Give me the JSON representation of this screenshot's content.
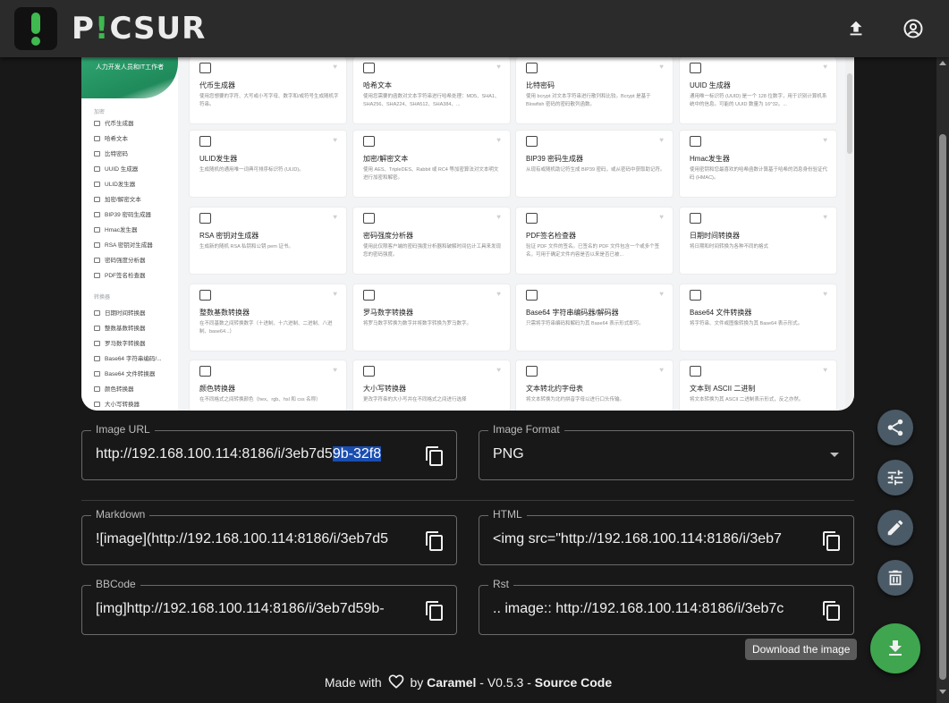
{
  "app": {
    "brand_prefix": "P",
    "brand_accent": "!",
    "brand_suffix": "CSUR",
    "accent_color": "#3fb950"
  },
  "appbar": {
    "upload_icon": "upload-icon",
    "account_icon": "account-circle-icon"
  },
  "preview": {
    "banner": "人力开发人员和IT工作者",
    "group_crypto": "加密",
    "group_convert": "转换器",
    "menu": [
      "代币生成器",
      "哈希文本",
      "比特密码",
      "UUID 生成器",
      "ULID发生器",
      "加密/解密文本",
      "BIP39 密码生成器",
      "Hmac发生器",
      "RSA 密钥对生成器",
      "密码强度分析器",
      "PDF签名检查器",
      "日期时间转换器",
      "整数基数转换器",
      "罗马数字转换器",
      "Base64 字符串编码/...",
      "Base64 文件转换器",
      "颜色转换器",
      "大小写转换器"
    ],
    "cards": [
      {
        "t": "代币生成器",
        "d": "使用您想要的字符、大写或小写字母、数字和/或符号生成随机字符串。"
      },
      {
        "t": "哈希文本",
        "d": "使用您需要的函数对文本字符串进行哈希处理：MD5、SHA1、SHA256、SHA224、SHA512、SHA384、..."
      },
      {
        "t": "比特密码",
        "d": "使用 bcrypt 对文本字符串进行散列和比较。Bcrypt 是基于 Blowfish 密码的密码散列函数。"
      },
      {
        "t": "UUID 生成器",
        "d": "通用唯一标识符 (UUID) 是一个 128 位数字，用于识别计算机系统中的信息。可能的 UUID 数量为 16^32。..."
      },
      {
        "t": "ULID发生器",
        "d": "生成随机的通用唯一词典可排序标识符 (ULID)。"
      },
      {
        "t": "加密/解密文本",
        "d": "使用 AES、TripleDES、Rabbit 或 RC4 等加密算法对文本明文进行加密和解密。"
      },
      {
        "t": "BIP39 密码生成器",
        "d": "从现有或随机助记符生成 BIP39 密码，或从密码中获取助记符。"
      },
      {
        "t": "Hmac发生器",
        "d": "使用密钥和您最喜欢的哈希函数计算基于哈希的消息身份验证代码 (HMAC)。"
      },
      {
        "t": "RSA 密钥对生成器",
        "d": "生成新的随机 RSA 私钥和公钥 pem 证书。"
      },
      {
        "t": "密码强度分析器",
        "d": "使用此仅限客户端的密码强度分析器和破解时间估计工具来发现您的密码强度。"
      },
      {
        "t": "PDF签名检查器",
        "d": "验证 PDF 文件的签名。已签名的 PDF 文件包含一个或多个签名，可用于确定文件内容是否以来是否已被..."
      },
      {
        "t": "日期时间转换器",
        "d": "将日期和时间转换为各种不同的格式"
      },
      {
        "t": "整数基数转换器",
        "d": "在不同基数之间转换数字（十进制、十六进制、二进制、八进制、base64...）"
      },
      {
        "t": "罗马数字转换器",
        "d": "将罗马数字转换为数字并将数字转换为罗马数字。"
      },
      {
        "t": "Base64 字符串编码器/解码器",
        "d": "只需将字符串编码和解码为其 Base64 表示形式即可。"
      },
      {
        "t": "Base64 文件转换器",
        "d": "将字符串、文件或图像转换为其 Base64 表示形式。"
      },
      {
        "t": "颜色转换器",
        "d": "在不同格式之间转换颜色（hex、rgb、hsl 和 css 名称）"
      },
      {
        "t": "大小写转换器",
        "d": "更改字符串的大小写并在不同格式之间进行选择"
      },
      {
        "t": "文本转北约字母表",
        "d": "将文本转换为北约拼音字母以进行口头传输。"
      },
      {
        "t": "文本到 ASCII 二进制",
        "d": "将文本转换为其 ASCII 二进制表示形式，反之亦然。"
      }
    ]
  },
  "fields": {
    "image_url": {
      "label": "Image URL",
      "value_pre": "http://192.168.100.114:8186/i/3eb7d5",
      "value_sel": "9b-32f8"
    },
    "image_format": {
      "label": "Image Format",
      "value": "PNG"
    },
    "markdown": {
      "label": "Markdown",
      "value": "![image](http://192.168.100.114:8186/i/3eb7d5"
    },
    "html": {
      "label": "HTML",
      "value": "<img src=\"http://192.168.100.114:8186/i/3eb7"
    },
    "bbcode": {
      "label": "BBCode",
      "value": "[img]http://192.168.100.114:8186/i/3eb7d59b-"
    },
    "rst": {
      "label": "Rst",
      "value": ".. image:: http://192.168.100.114:8186/i/3eb7c"
    }
  },
  "actions": {
    "tooltip": "Download the image",
    "fab_color": "#4a5a66",
    "download_color": "#3fa64f"
  },
  "footer": {
    "made_with": "Made with",
    "by": "by",
    "author": "Caramel",
    "version": "- V0.5.3 -",
    "source": "Source Code"
  }
}
